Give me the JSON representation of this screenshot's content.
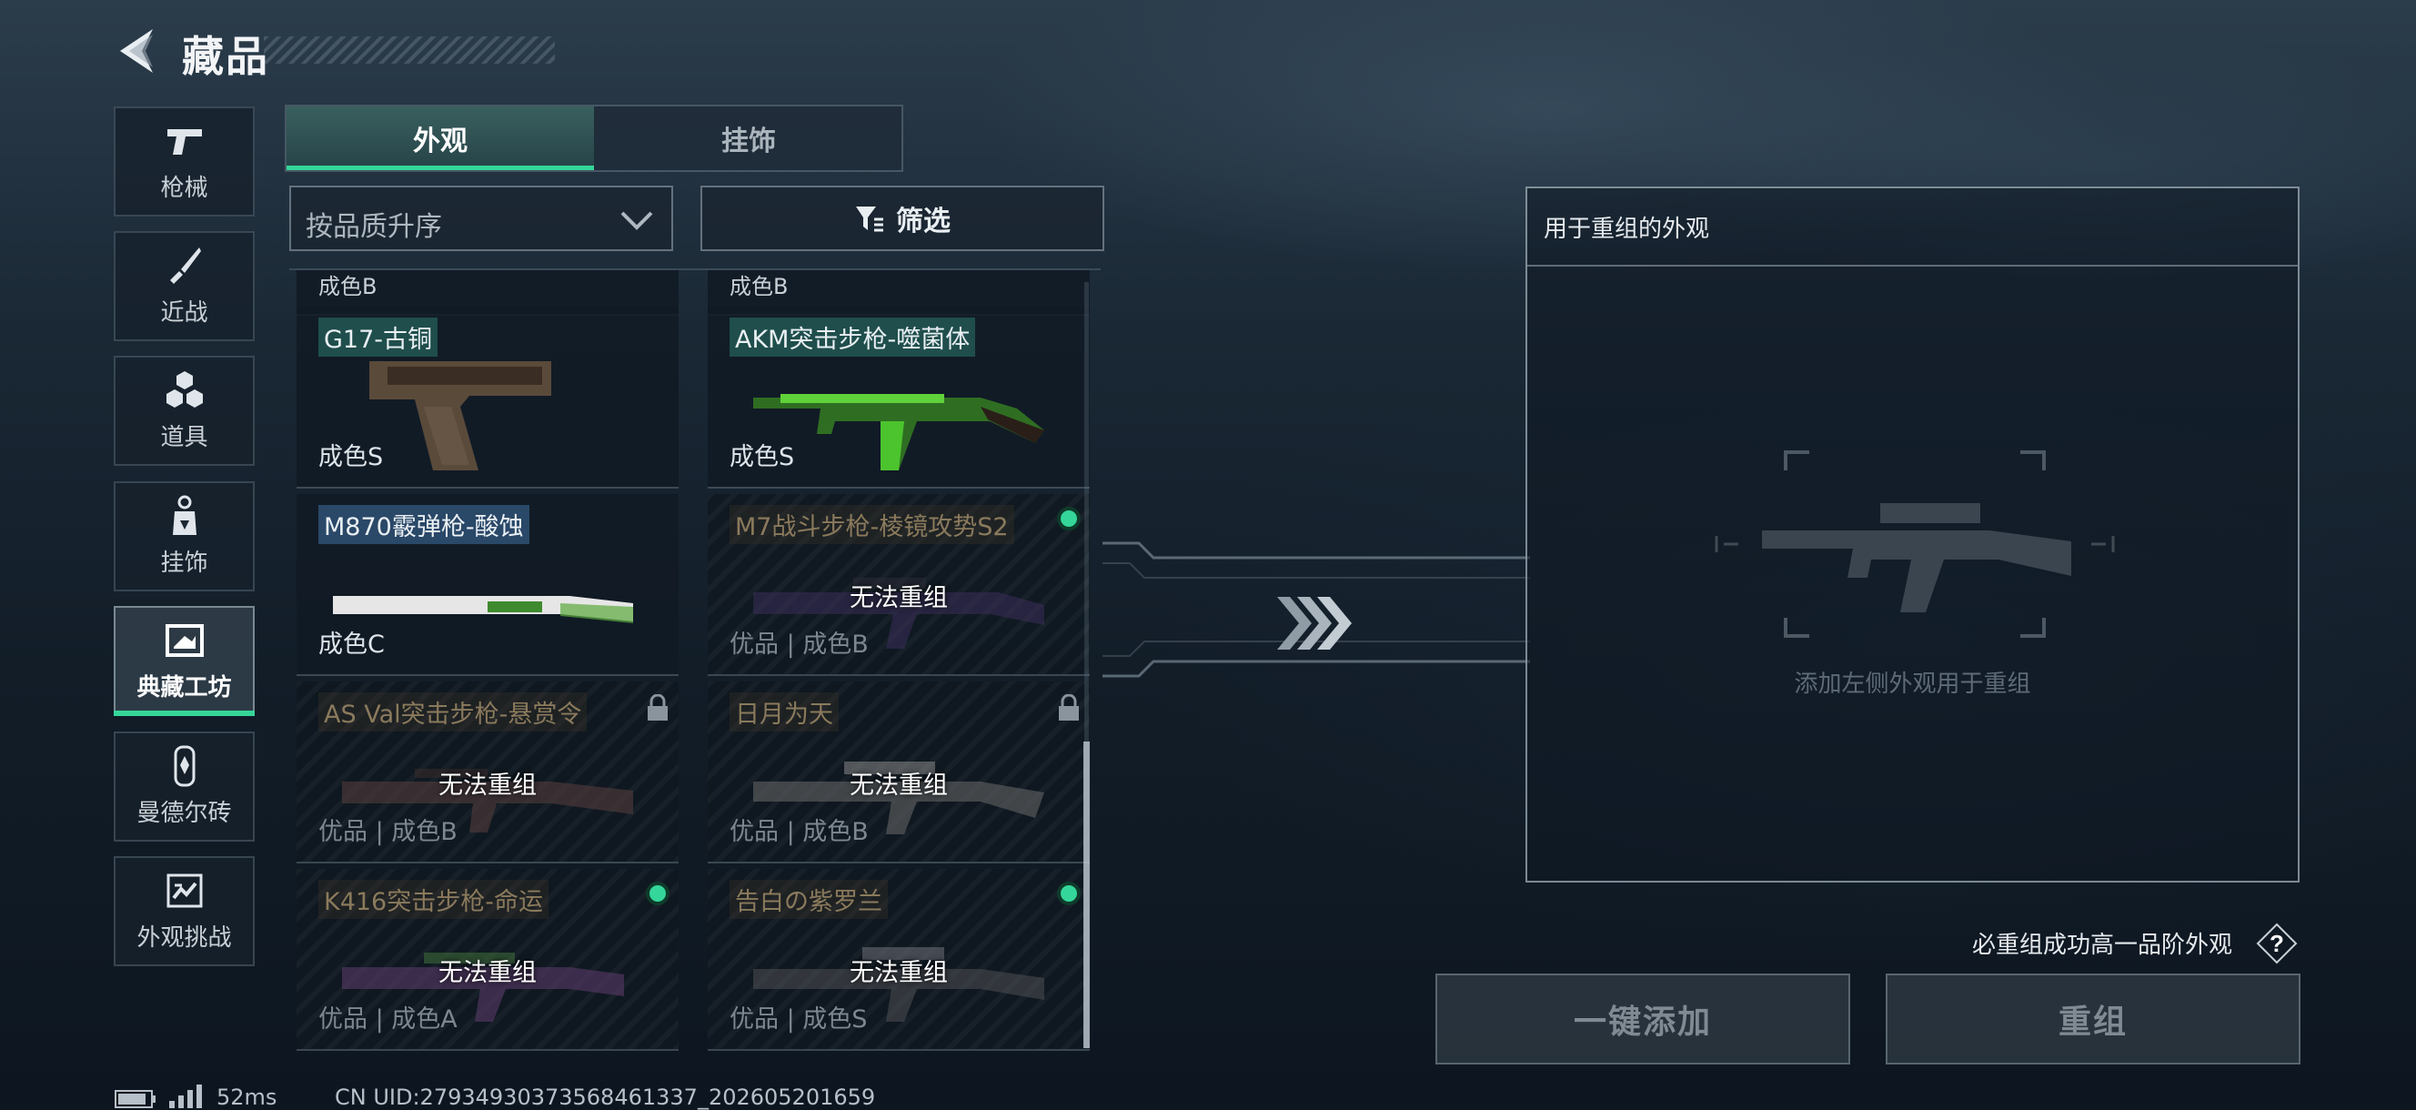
{
  "header": {
    "title": "藏品"
  },
  "sidebar": {
    "items": [
      {
        "label": "枪械",
        "icon": "pistol-icon"
      },
      {
        "label": "近战",
        "icon": "knife-icon"
      },
      {
        "label": "道具",
        "icon": "hexagons-icon"
      },
      {
        "label": "挂饰",
        "icon": "charm-icon"
      },
      {
        "label": "典藏工坊",
        "icon": "workshop-icon",
        "active": true
      },
      {
        "label": "曼德尔砖",
        "icon": "brick-icon"
      },
      {
        "label": "外观挑战",
        "icon": "challenge-icon"
      }
    ]
  },
  "tabs": {
    "skins": "外观",
    "charms": "挂饰"
  },
  "sort": {
    "label": "按品质升序"
  },
  "filter": {
    "label": "筛选"
  },
  "grid": {
    "partial_top": [
      "成色B",
      "成色B"
    ],
    "items": [
      {
        "name": "G17-古铜",
        "grade": "成色S",
        "status": "",
        "disabled": false,
        "marker": ""
      },
      {
        "name": "AKM突击步枪-噬菌体",
        "grade": "成色S",
        "status": "",
        "disabled": false,
        "marker": ""
      },
      {
        "name": "M870霰弹枪-酸蚀",
        "grade": "成色C",
        "status": "",
        "disabled": false,
        "marker": ""
      },
      {
        "name": "M7战斗步枪-棱镜攻势S2",
        "grade": "优品 | 成色B",
        "status": "无法重组",
        "disabled": true,
        "marker": "dot"
      },
      {
        "name": "AS Val突击步枪-悬赏令",
        "grade": "优品 | 成色B",
        "status": "无法重组",
        "disabled": true,
        "marker": "lock"
      },
      {
        "name": "日月为天",
        "grade": "优品 | 成色B",
        "status": "无法重组",
        "disabled": true,
        "marker": "lock"
      },
      {
        "name": "K416突击步枪-命运",
        "grade": "优品 | 成色A",
        "status": "无法重组",
        "disabled": true,
        "marker": "dot"
      },
      {
        "name": "告白の紫罗兰",
        "grade": "优品 | 成色S",
        "status": "无法重组",
        "disabled": true,
        "marker": "dot"
      }
    ]
  },
  "remix_panel": {
    "title": "用于重组的外观",
    "hint": "添加左侧外观用于重组"
  },
  "footer": {
    "guarantee": "必重组成功高一品阶外观",
    "add_all": "一键添加",
    "remix": "重组"
  },
  "status_bar": {
    "ping": "52ms",
    "uid": "CN UID:27934930373568461337_202605201659"
  },
  "colors": {
    "accent": "#35d69a",
    "name_tag_blue": "#2a4868",
    "name_tag_teal": "#1f4e4c",
    "disabled_name": "#8a7a5c"
  }
}
